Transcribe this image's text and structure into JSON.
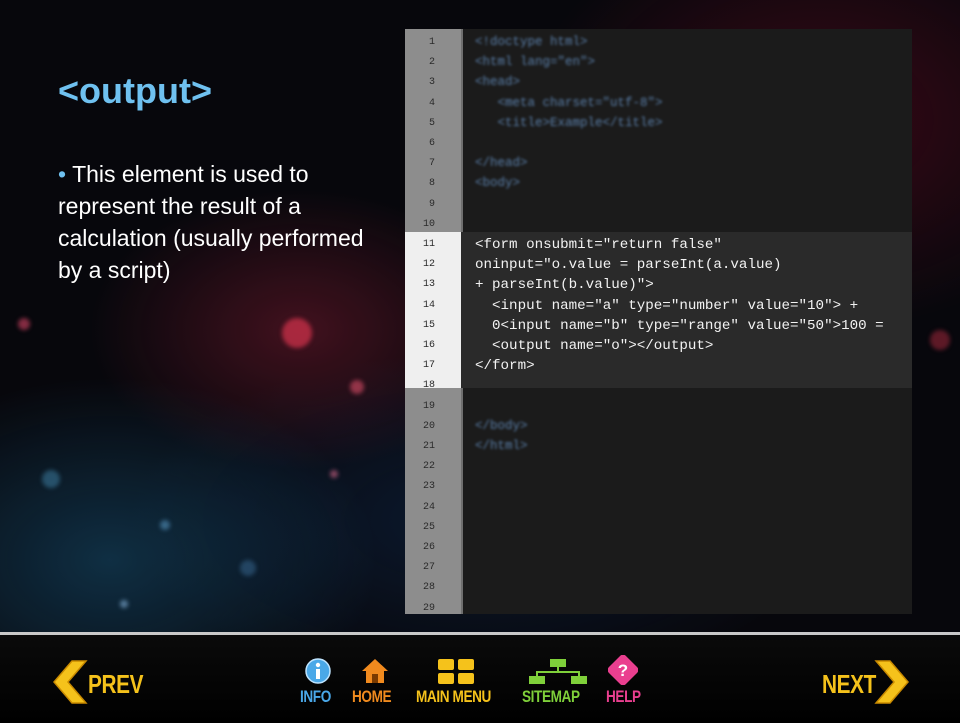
{
  "slide": {
    "title": "<output>",
    "bullet": "This element is used to represent the result of a calculation (usually performed by a script)"
  },
  "code": {
    "line_numbers": [
      "1",
      "2",
      "3",
      "4",
      "5",
      "6",
      "7",
      "8",
      "9",
      "10",
      "11",
      "12",
      "13",
      "14",
      "15",
      "16",
      "17",
      "18",
      "19",
      "20",
      "21",
      "22",
      "23",
      "24",
      "25",
      "26",
      "27",
      "28",
      "29"
    ],
    "dim_lines_top": [
      "<!doctype html>",
      "<html lang=\"en\">",
      "<head>",
      "   <meta charset=\"utf-8\">",
      "   <title>Example</title>",
      "",
      "</head>",
      "<body>"
    ],
    "highlighted_lines": [
      "<form onsubmit=\"return false\"",
      "oninput=\"o.value = parseInt(a.value)",
      "+ parseInt(b.value)\">",
      "  <input name=\"a\" type=\"number\" value=\"10\"> +",
      "  0<input name=\"b\" type=\"range\" value=\"50\">100 =",
      "  <output name=\"o\"></output>",
      "</form>"
    ],
    "dim_lines_bottom": [
      "</body>",
      "</html>"
    ]
  },
  "nav": {
    "prev": "PREV",
    "info": "INFO",
    "home": "HOME",
    "main_menu": "MAIN MENU",
    "sitemap": "SITEMAP",
    "help": "HELP",
    "next": "NEXT"
  },
  "colors": {
    "title": "#6fc1f0",
    "nav_yellow": "#f5c21b",
    "nav_blue": "#4aa8e8",
    "nav_orange": "#f08a1e",
    "nav_green": "#7fd03a",
    "nav_pink": "#ea3f8f"
  }
}
